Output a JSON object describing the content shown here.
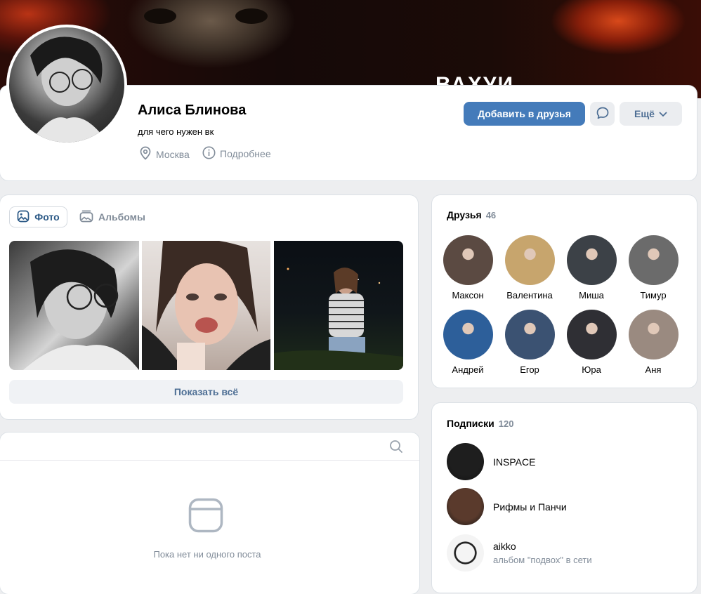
{
  "cover": {
    "word": "ВАХУИ"
  },
  "profile": {
    "name": "Алиса Блинова",
    "status": "для чего нужен вк",
    "city": "Москва",
    "more": "Подробнее",
    "add_friend": "Добавить в друзья",
    "menu": "Ещё"
  },
  "photos": {
    "tab_active": "Фото",
    "tab_albums": "Альбомы",
    "show_all": "Показать всё"
  },
  "wall": {
    "empty": "Пока нет ни одного поста"
  },
  "friends": {
    "title": "Друзья",
    "count": "46",
    "items": [
      {
        "name": "Максон",
        "color": "#5b4a42"
      },
      {
        "name": "Валентина",
        "color": "#c7a56d"
      },
      {
        "name": "Миша",
        "color": "#3c4147"
      },
      {
        "name": "Тимур",
        "color": "#6b6b6b"
      },
      {
        "name": "Андрей",
        "color": "#2d5f9a"
      },
      {
        "name": "Егор",
        "color": "#3b5272"
      },
      {
        "name": "Юра",
        "color": "#2f2f34"
      },
      {
        "name": "Аня",
        "color": "#9a8a80"
      }
    ]
  },
  "subs": {
    "title": "Подписки",
    "count": "120",
    "items": [
      {
        "name": "INSPACE",
        "desc": "",
        "color": "#1e1e1e"
      },
      {
        "name": "Рифмы и Панчи",
        "desc": "",
        "color": "#5a3a2c"
      },
      {
        "name": "aikko",
        "desc": "альбом \"подвох\" в сети",
        "color": "#e8e8e8"
      }
    ]
  }
}
